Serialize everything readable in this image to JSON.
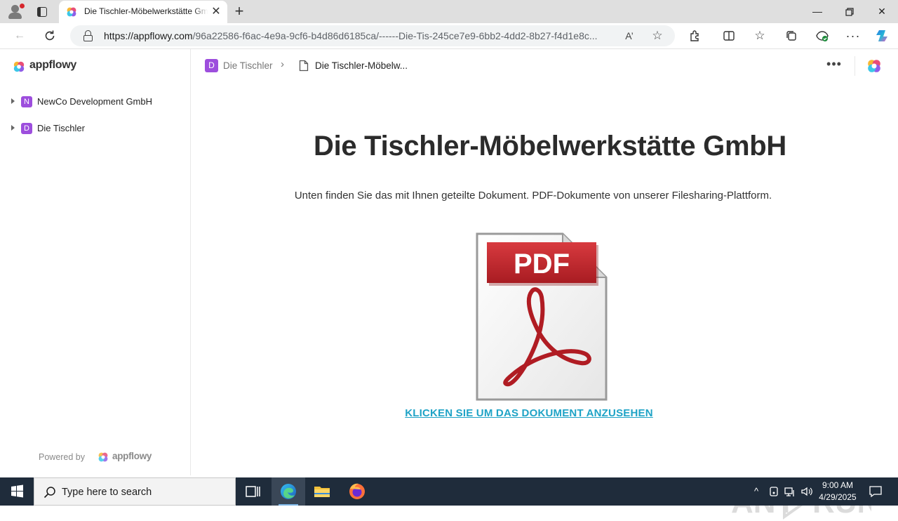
{
  "browser": {
    "tab_title": "Die Tischler-Möbelwerkstätte GmbH",
    "url_domain": "https://appflowy.com",
    "url_path": "/96a22586-f6ac-4e9a-9cf6-b4d86d6185ca/------Die-Tis-245ce7e9-6bb2-4dd2-8b27-f4d1e8c..."
  },
  "sidebar": {
    "logo_text": "appflowy",
    "workspaces": [
      {
        "badge": "N",
        "label": "NewCo Development GmbH"
      },
      {
        "badge": "D",
        "label": "Die Tischler"
      }
    ],
    "powered_by": "Powered by",
    "powered_logo_text": "appflowy"
  },
  "header": {
    "breadcrumb_badge": "D",
    "breadcrumb_parent": "Die Tischler",
    "breadcrumb_current": "Die Tischler-Möbelw..."
  },
  "document": {
    "title": "Die Tischler-Möbelwerkstätte GmbH",
    "subtitle": "Unten finden Sie das mit Ihnen geteilte Dokument. PDF-Dokumente von unserer Filesharing-Plattform.",
    "pdf_label": "PDF",
    "link_text": "KLICKEN SIE UM DAS DOKUMENT ANZUSEHEN"
  },
  "watermark": {
    "left": "ANY",
    "right": "RUN"
  },
  "taskbar": {
    "search_placeholder": "Type here to search",
    "time": "9:00 AM",
    "date": "4/29/2025"
  },
  "colors": {
    "workspace_badge": "#9d4edd",
    "link": "#1fa3c6",
    "pdf_red": "#c4262e",
    "taskbar": "#1f2c3b"
  }
}
